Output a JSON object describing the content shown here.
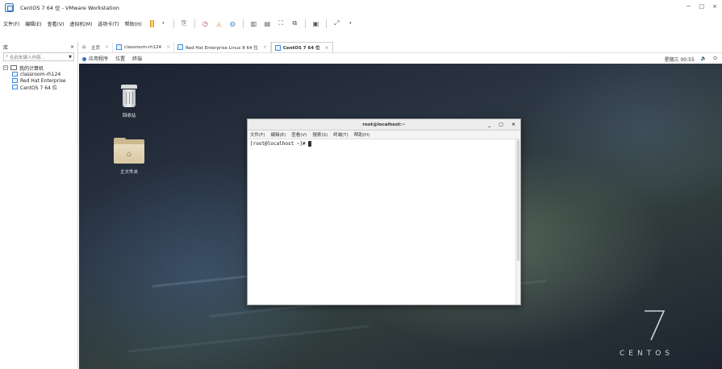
{
  "window": {
    "title": "CentOS 7 64 位 - VMware Workstation",
    "controls": [
      "−",
      "□",
      "×"
    ]
  },
  "menubar": {
    "items": [
      "文件(F)",
      "编辑(E)",
      "查看(V)",
      "虚拟机(M)",
      "选项卡(T)",
      "帮助(H)"
    ]
  },
  "library": {
    "title": "库",
    "close": "×",
    "search_placeholder": "在此处键入内容...",
    "root": "我的计算机",
    "vms": [
      "classroom-rh124",
      "Red Hat Enterprise",
      "CentOS 7 64 位"
    ]
  },
  "tabs": [
    {
      "label": "主页",
      "close": "×"
    },
    {
      "label": "classroom-rh124",
      "close": "×"
    },
    {
      "label": "Red Hat Enterprise Linux 8 64 位",
      "close": "×"
    },
    {
      "label": "CentOS 7 64 位",
      "close": "×",
      "active": true
    }
  ],
  "gnome": {
    "applications": "应用程序",
    "places": "位置",
    "terminal": "终端",
    "clock": "星期三 00:55",
    "volume": "🔈",
    "power": "⏻"
  },
  "desktop": {
    "trash_label": "回收站",
    "home_label": "主文件夹",
    "brand_number": "7",
    "brand_word": "CENTOS"
  },
  "terminal": {
    "title": "root@localhost:~",
    "controls": [
      "_",
      "□",
      "×"
    ],
    "menu": [
      "文件(F)",
      "编辑(E)",
      "查看(V)",
      "搜索(S)",
      "终端(T)",
      "帮助(H)"
    ],
    "prompt": "[root@localhost ~]# "
  },
  "colors": {
    "accent": "#3d8de0",
    "pause": "#f0a020"
  }
}
